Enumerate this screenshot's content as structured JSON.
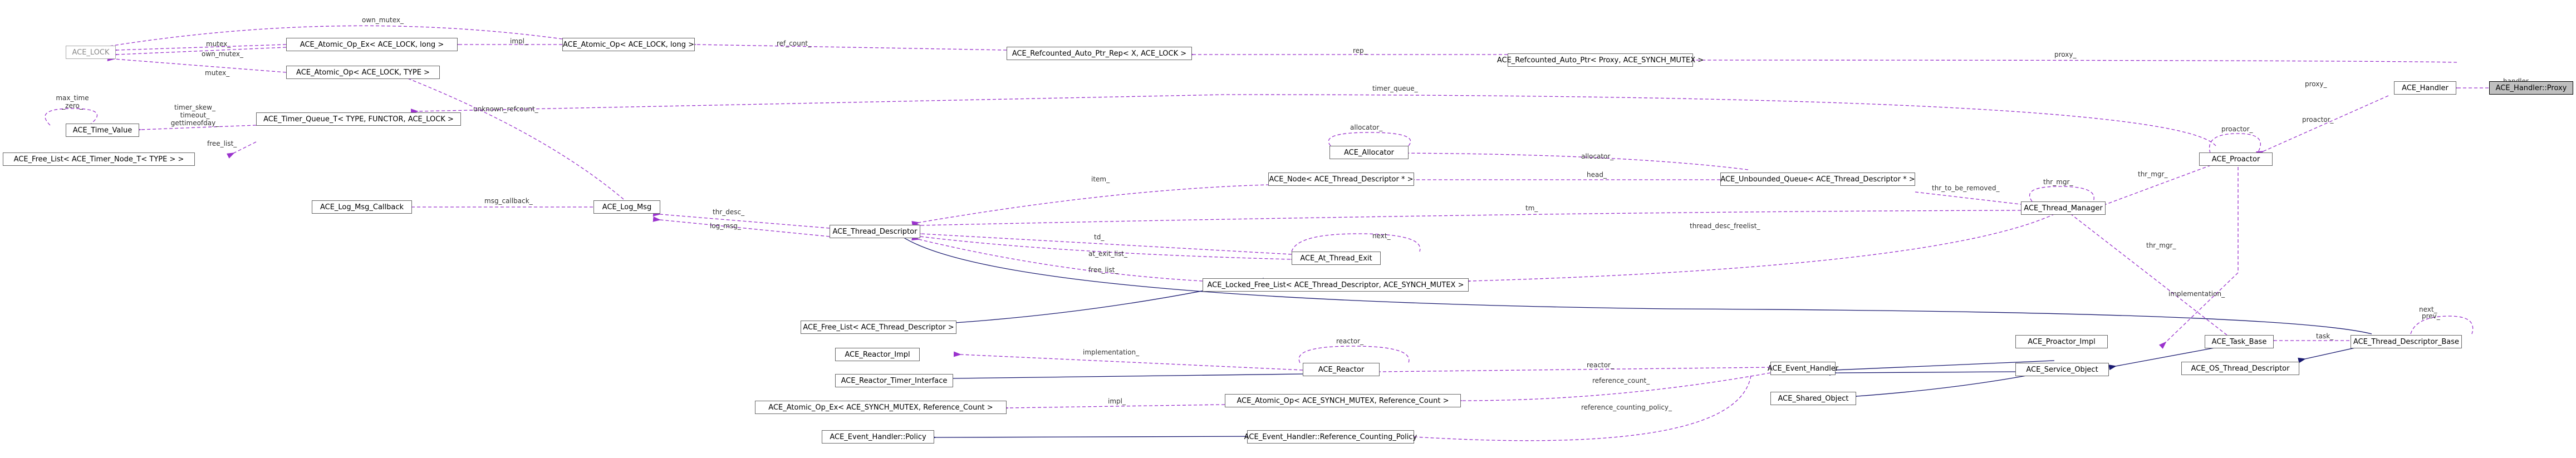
{
  "nodes": {
    "proxy": "ACE_Handler::Proxy",
    "handler": "ACE_Handler",
    "refcounted_auto_ptr_proxy": "ACE_Refcounted_Auto_Ptr< Proxy, ACE_SYNCH_MUTEX >",
    "refcounted_auto_ptr_rep": "ACE_Refcounted_Auto_Ptr_Rep< X, ACE_LOCK >",
    "atomic_op_lock": "ACE_Atomic_Op< ACE_LOCK, long >",
    "atomic_op_ex_lock": "ACE_Atomic_Op_Ex< ACE_LOCK, long >",
    "ace_lock": "ACE_LOCK",
    "atomic_op_lock_type": "ACE_Atomic_Op< ACE_LOCK, TYPE >",
    "time_value": "ACE_Time_Value",
    "timer_queue": "ACE_Timer_Queue_T< TYPE, FUNCTOR, ACE_LOCK >",
    "free_list_timer": "ACE_Free_List< ACE_Timer_Node_T< TYPE > >",
    "proactor": "ACE_Proactor",
    "allocator": "ACE_Allocator",
    "node_thread_desc": "ACE_Node< ACE_Thread_Descriptor * >",
    "unbounded_queue": "ACE_Unbounded_Queue< ACE_Thread_Descriptor * >",
    "log_msg_callback": "ACE_Log_Msg_Callback",
    "log_msg": "ACE_Log_Msg",
    "thread_descriptor": "ACE_Thread_Descriptor",
    "thread_manager": "ACE_Thread_Manager",
    "at_thread_exit": "ACE_At_Thread_Exit",
    "locked_free_list": "ACE_Locked_Free_List< ACE_Thread_Descriptor, ACE_SYNCH_MUTEX >",
    "free_list_thread_desc": "ACE_Free_List< ACE_Thread_Descriptor >",
    "reactor_impl": "ACE_Reactor_Impl",
    "reactor": "ACE_Reactor",
    "reactor_timer_interface": "ACE_Reactor_Timer_Interface",
    "proactor_impl": "ACE_Proactor_Impl",
    "event_handler": "ACE_Event_Handler",
    "task_base": "ACE_Task_Base",
    "thread_descriptor_base": "ACE_Thread_Descriptor_Base",
    "service_object": "ACE_Service_Object",
    "os_thread_descriptor": "ACE_OS_Thread_Descriptor",
    "shared_object": "ACE_Shared_Object",
    "atomic_op_ex_refcount": "ACE_Atomic_Op_Ex< ACE_SYNCH_MUTEX, Reference_Count >",
    "atomic_op_refcount": "ACE_Atomic_Op< ACE_SYNCH_MUTEX, Reference_Count >",
    "eh_policy": "ACE_Event_Handler::Policy",
    "eh_ref_counting_policy": "ACE_Event_Handler::Reference_Counting_Policy"
  },
  "edge_labels": {
    "handler": "handler_",
    "proxy": "proxy_",
    "rep": "rep_",
    "ref_count": "ref_count_",
    "own_mutex_top": "own_mutex_",
    "impl_atomic": "impl_",
    "mutex_a": "mutex_",
    "own_mutex_b": "own_mutex_",
    "mutex_b": "mutex_",
    "timer_queue": "timer_queue_",
    "max_time": "max_time\n_zero_",
    "timer_skew": "timer_skew_\ntimeout_\ngettimeofday_",
    "free_list": "free_list_",
    "unknown_refcount": "unknown_refcount_",
    "proactor_self": "proactor_",
    "proactor_h": "proactor_",
    "allocator_self": "allocator_",
    "allocator_q": "allocator_",
    "head": "head_",
    "item": "item_",
    "thr_mgr_self": "thr_mgr_",
    "thr_mgr_p": "thr_mgr_",
    "thr_to_be_removed": "thr_to_be_removed_",
    "msg_callback": "msg_callback_",
    "thr_desc": "thr_desc_",
    "log_msg": "log_msg_",
    "tm": "tm_",
    "td": "td_",
    "at_exit_list": "at_exit_list_",
    "next_self": "next_",
    "free_list_td": "free_list_",
    "thread_desc_freelist": "thread_desc_freelist_",
    "implementation_p": "implementation_",
    "thr_mgr_task": "thr_mgr_",
    "reactor_self": "reactor_",
    "implementation_r": "implementation_",
    "reactor_eh": "reactor_",
    "task": "task_",
    "next_prev": "next_\nprev_",
    "reference_count": "reference_count_",
    "impl_refcount": "impl_",
    "ref_counting_policy": "reference_counting_policy_"
  },
  "colors": {
    "usage_edge": "#9a32cd",
    "inheritance_edge": "#191970",
    "highlight_node": "#bfbfbf"
  }
}
